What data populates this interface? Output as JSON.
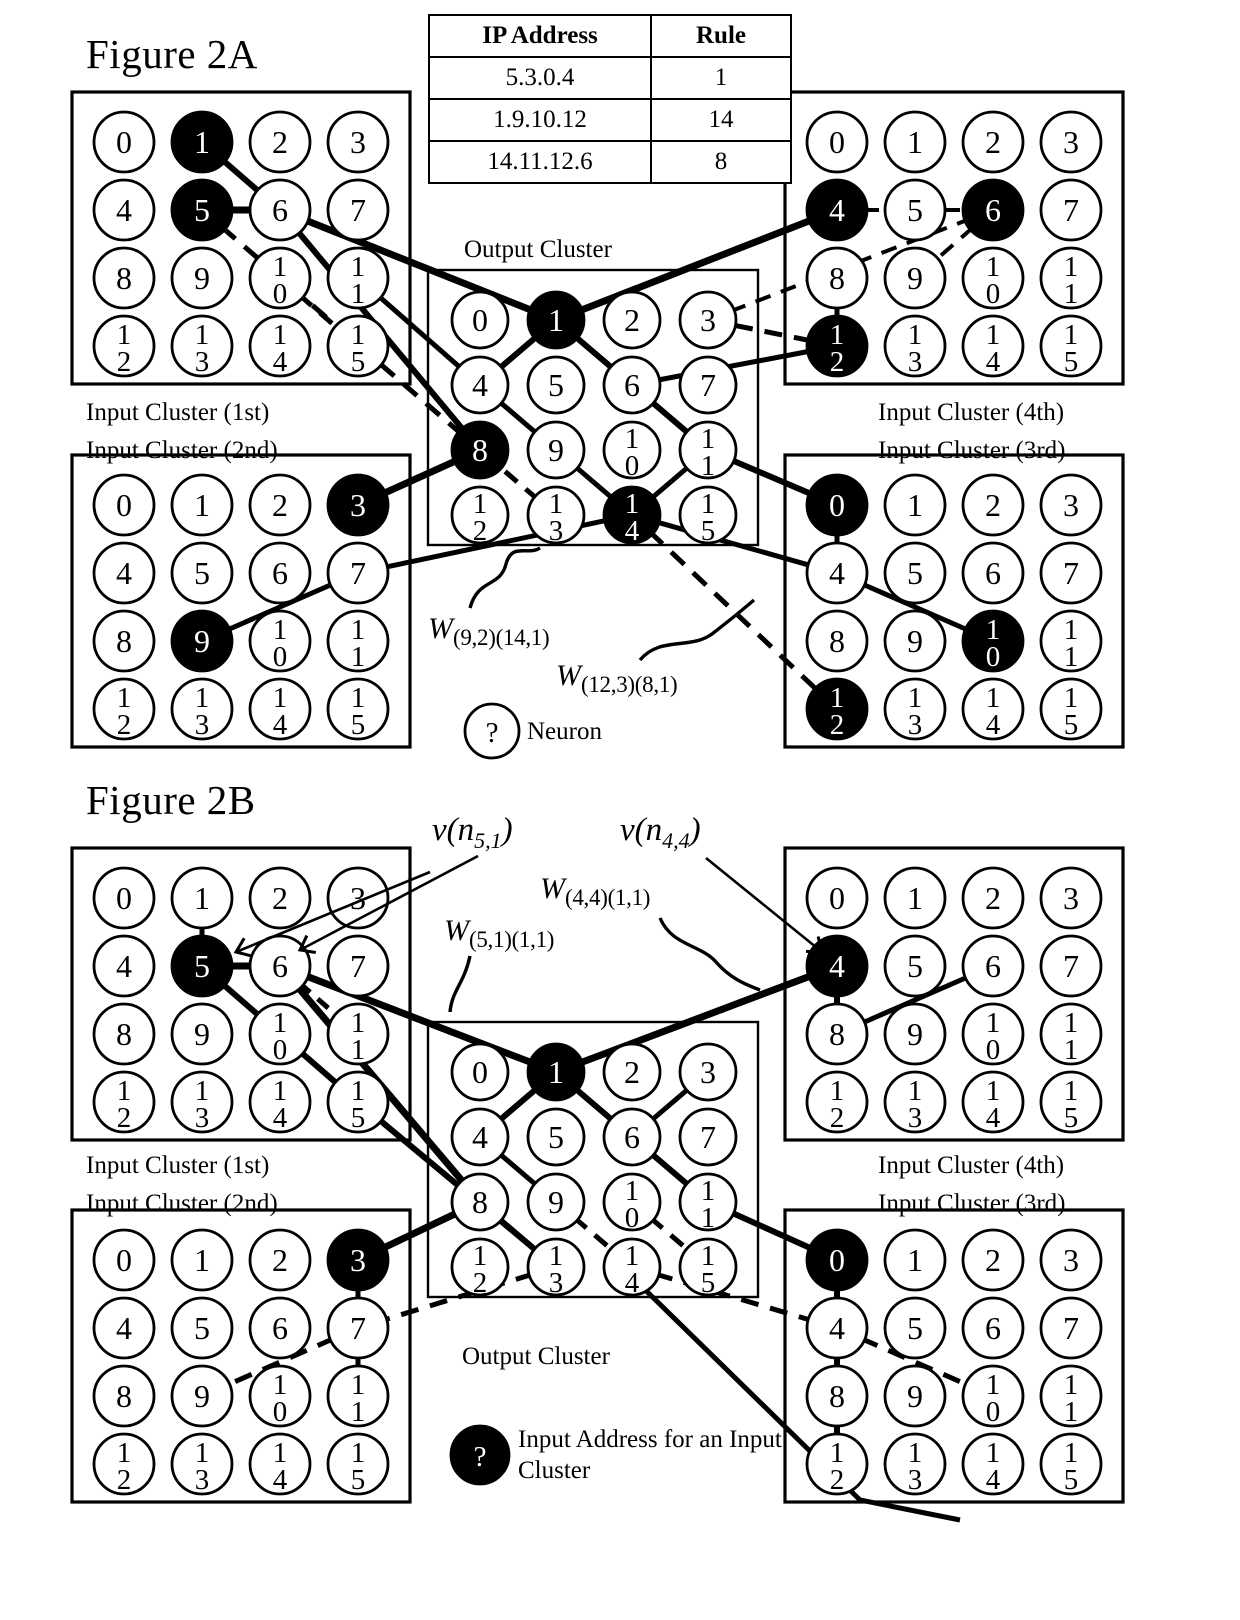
{
  "figures": {
    "a": {
      "title": "Figure 2A"
    },
    "b": {
      "title": "Figure 2B"
    }
  },
  "ip_table": {
    "headers": [
      "IP Address",
      "Rule"
    ],
    "rows": [
      {
        "ip": "5.3.0.4",
        "rule": "1"
      },
      {
        "ip": "1.9.10.12",
        "rule": "14"
      },
      {
        "ip": "14.11.12.6",
        "rule": "8"
      }
    ]
  },
  "labels": {
    "input_1st": "Input Cluster (1st)",
    "input_2nd": "Input Cluster (2nd)",
    "input_3rd": "Input Cluster (3rd)",
    "input_4th": "Input Cluster (4th)",
    "output_cluster": "Output Cluster",
    "neuron_legend": "Neuron",
    "input_address_legend": "Input Address for an Input Cluster",
    "neuron_marker": "?",
    "address_marker": "?"
  },
  "weight_labels": {
    "a1_main": "W",
    "a1_sub": "(9,2)(14,1)",
    "a2_main": "W",
    "a2_sub": "(12,3)(8,1)",
    "b_w1_main": "W",
    "b_w1_sub": "(5,1)(1,1)",
    "b_w2_main": "W",
    "b_w2_sub": "(4,4)(1,1)",
    "b_v1_main": "v(n",
    "b_v1_sub": "5,1",
    "b_v1_tail": ")",
    "b_v2_main": "v(n",
    "b_v2_sub": "4,4",
    "b_v2_tail": ")"
  },
  "node_numbers": [
    "0",
    "1",
    "2",
    "3",
    "4",
    "5",
    "6",
    "7",
    "8",
    "9",
    "10",
    "11",
    "12",
    "13",
    "14",
    "15"
  ],
  "clusters": {
    "a_input_1st": {
      "name": "Input Cluster (1st)",
      "filled": [
        1,
        5
      ]
    },
    "a_input_2nd": {
      "name": "Input Cluster (2nd)",
      "filled": [
        3,
        9
      ]
    },
    "a_input_3rd": {
      "name": "Input Cluster (3rd)",
      "filled": [
        0,
        10,
        12
      ]
    },
    "a_input_4th": {
      "name": "Input Cluster (4th)",
      "filled": [
        4,
        6,
        12
      ]
    },
    "a_output": {
      "name": "Output Cluster",
      "filled": [
        1,
        8,
        14
      ]
    },
    "b_input_1st": {
      "name": "Input Cluster (1st)",
      "filled": [
        5
      ]
    },
    "b_input_2nd": {
      "name": "Input Cluster (2nd)",
      "filled": [
        3
      ]
    },
    "b_input_3rd": {
      "name": "Input Cluster (3rd)",
      "filled": [
        0
      ]
    },
    "b_input_4th": {
      "name": "Input Cluster (4th)",
      "filled": [
        4
      ]
    },
    "b_output": {
      "name": "Output Cluster",
      "filled": [
        1
      ]
    }
  },
  "colors": {
    "ink": "#000000",
    "paper": "#ffffff"
  }
}
